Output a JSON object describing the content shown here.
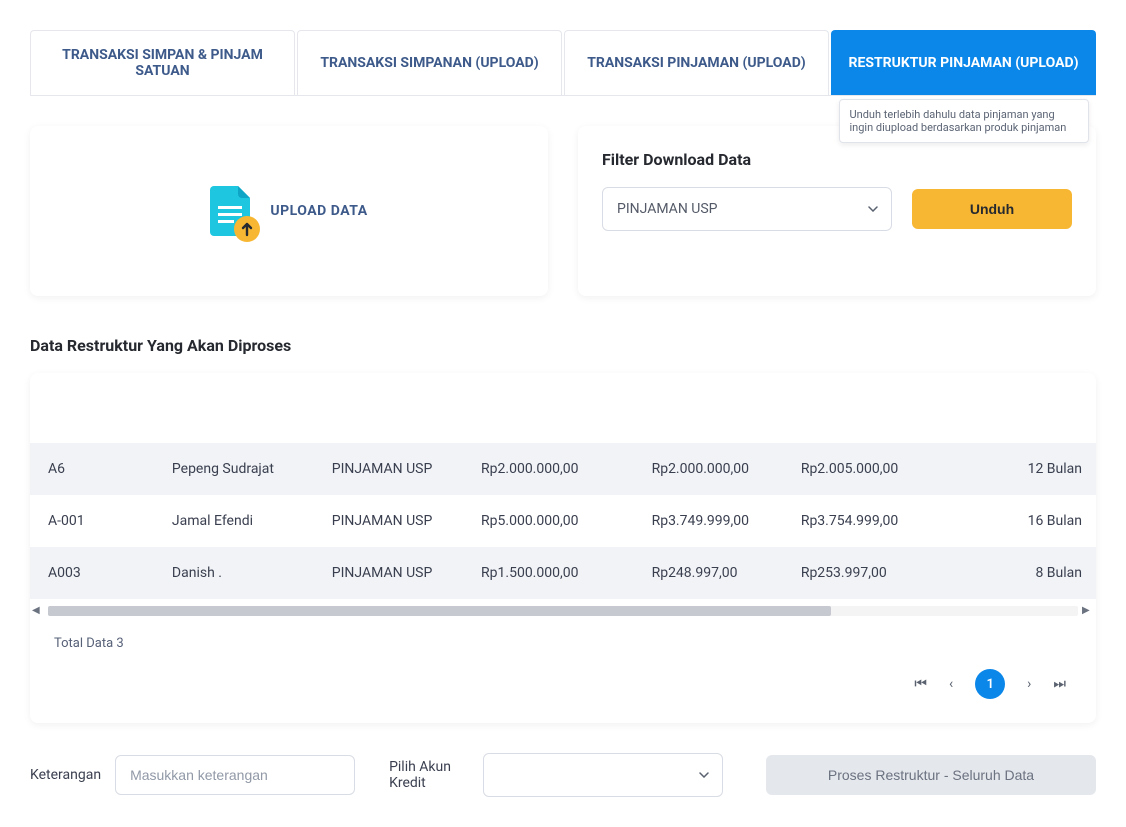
{
  "tabs": [
    {
      "label": "TRANSAKSI SIMPAN & PINJAM SATUAN"
    },
    {
      "label": "TRANSAKSI SIMPANAN (UPLOAD)"
    },
    {
      "label": "TRANSAKSI PINJAMAN (UPLOAD)"
    },
    {
      "label": "RESTRUKTUR PINJAMAN (UPLOAD)"
    }
  ],
  "tooltip": "Unduh terlebih dahulu data pinjaman yang ingin diupload berdasarkan produk pinjaman",
  "upload": {
    "label": "UPLOAD DATA"
  },
  "filter": {
    "title": "Filter Download Data",
    "selected": "PINJAMAN USP",
    "download_label": "Unduh"
  },
  "section_title": "Data Restruktur Yang Akan Diproses",
  "table": {
    "rows": [
      {
        "c0": "A6",
        "c1": "Pepeng Sudrajat",
        "c2": "PINJAMAN USP",
        "c3": "Rp2.000.000,00",
        "c4": "Rp2.000.000,00",
        "c5": "Rp2.005.000,00",
        "c6": "12 Bulan"
      },
      {
        "c0": "A-001",
        "c1": "Jamal Efendi",
        "c2": "PINJAMAN USP",
        "c3": "Rp5.000.000,00",
        "c4": "Rp3.749.999,00",
        "c5": "Rp3.754.999,00",
        "c6": "16 Bulan"
      },
      {
        "c0": "A003",
        "c1": "Danish .",
        "c2": "PINJAMAN USP",
        "c3": "Rp1.500.000,00",
        "c4": "Rp248.997,00",
        "c5": "Rp253.997,00",
        "c6": "8 Bulan"
      }
    ],
    "total_text": "Total Data 3"
  },
  "pagination": {
    "current": "1"
  },
  "bottom": {
    "keterangan_label": "Keterangan",
    "keterangan_placeholder": "Masukkan keterangan",
    "akun_label": "Pilih Akun Kredit",
    "submit_label": "Proses Restruktur - Seluruh Data"
  },
  "colors": {
    "primary": "#0b87ea",
    "accent": "#f7b733"
  }
}
